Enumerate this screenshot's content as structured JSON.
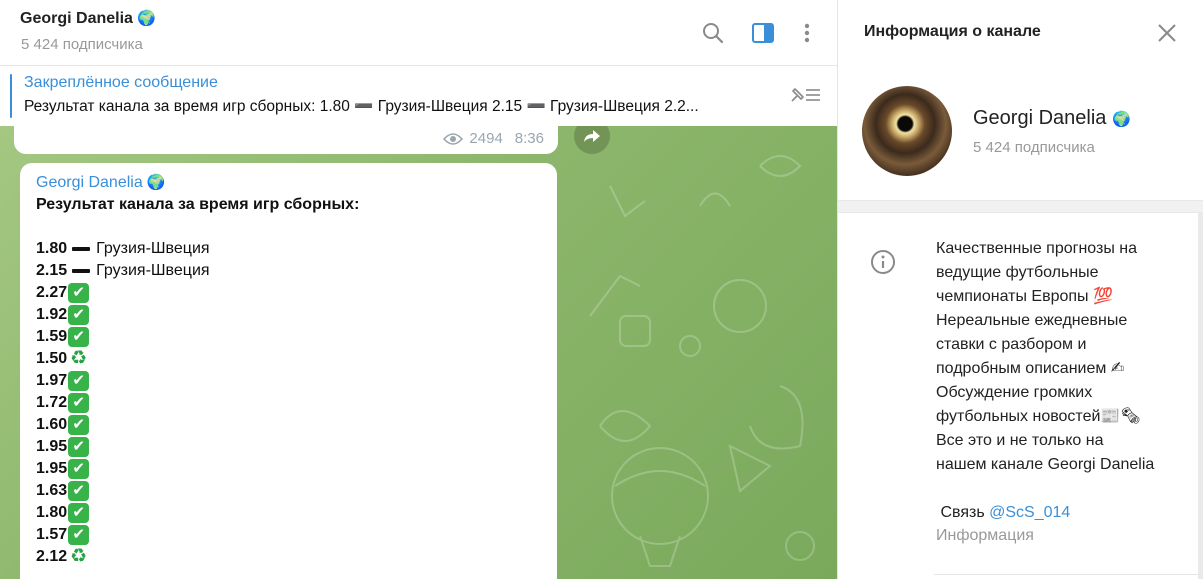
{
  "header": {
    "title": "Georgi Danelia",
    "title_emoji": "🌍",
    "subscribers": "5 424 подписчика"
  },
  "pinned": {
    "title": "Закреплённое сообщение",
    "text": "Результат канала за время игр сборных:  1.80 ➖  Грузия-Швеция  2.15 ➖ Грузия-Швеция  2.2..."
  },
  "previous_message": {
    "views": "2494",
    "time": "8:36"
  },
  "message": {
    "author": "Georgi Danelia",
    "author_emoji": "🌍",
    "headline": "Результат канала за время игр сборных:",
    "rows": [
      {
        "value": "1.80",
        "mark": "dash",
        "text": "Грузия-Швеция"
      },
      {
        "value": "2.15",
        "mark": "dash",
        "text": "Грузия-Швеция"
      },
      {
        "value": "2.27",
        "mark": "check",
        "text": ""
      },
      {
        "value": "1.92",
        "mark": "check",
        "text": ""
      },
      {
        "value": "1.59",
        "mark": "check",
        "text": ""
      },
      {
        "value": "1.50",
        "mark": "recycle",
        "text": ""
      },
      {
        "value": "1.97",
        "mark": "check",
        "text": ""
      },
      {
        "value": "1.72",
        "mark": "check",
        "text": ""
      },
      {
        "value": "1.60",
        "mark": "check",
        "text": ""
      },
      {
        "value": "1.95",
        "mark": "check",
        "text": ""
      },
      {
        "value": "1.95",
        "mark": "check",
        "text": ""
      },
      {
        "value": "1.63",
        "mark": "check",
        "text": ""
      },
      {
        "value": "1.80",
        "mark": "check",
        "text": ""
      },
      {
        "value": "1.57",
        "mark": "check",
        "text": ""
      },
      {
        "value": "2.12",
        "mark": "recycle",
        "text": ""
      }
    ]
  },
  "info_panel": {
    "title": "Информация о канале",
    "name": "Georgi Danelia",
    "name_emoji": "🌍",
    "subscribers": "5 424 подписчика",
    "description_lines": [
      "Качественные прогнозы на",
      "ведущие футбольные",
      "чемпионаты Европы 💯",
      "Нереальные ежедневные",
      "ставки с разбором и",
      "подробным описанием ✍",
      "Обсуждение громких",
      "футбольных новостей📰🗞",
      "Все это и не только на",
      "нашем канале Georgi Danelia"
    ],
    "contact_label": "Связь",
    "contact_link": "@ScS_014",
    "section_label": "Информация"
  },
  "colors": {
    "accent": "#3a8fd8",
    "wallpaper": "#8cb66b",
    "check_green": "#37b34a"
  },
  "icons": {
    "search": "search-icon",
    "panel_toggle": "sidebar-toggle-icon",
    "more": "more-vertical-icon",
    "pinned_list": "pinned-list-icon",
    "views": "eye-icon",
    "forward": "forward-icon",
    "close": "close-icon",
    "info": "info-icon"
  }
}
